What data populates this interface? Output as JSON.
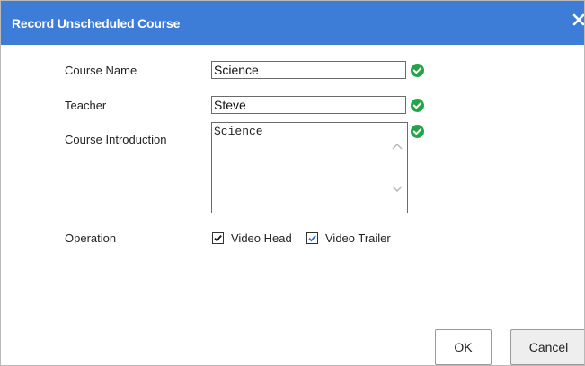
{
  "dialog": {
    "title": "Record Unscheduled Course",
    "close_glyph": "✕"
  },
  "form": {
    "course_name": {
      "label": "Course Name",
      "value": "Science",
      "status_icon": "check-circle-icon"
    },
    "teacher": {
      "label": "Teacher",
      "value": "Steve",
      "status_icon": "check-circle-icon"
    },
    "course_introduction": {
      "label": "Course Introduction",
      "value": "Science",
      "status_icon": "check-circle-icon"
    },
    "operation": {
      "label": "Operation",
      "options": [
        {
          "label": "Video Head",
          "checked": true
        },
        {
          "label": "Video Trailer",
          "checked": true
        }
      ]
    }
  },
  "buttons": {
    "ok_label": "OK",
    "cancel_label": "Cancel"
  },
  "colors": {
    "titlebar": "#3d7dd8",
    "valid_green": "#25a348",
    "checkbox_blue": "#2b6fcf"
  }
}
